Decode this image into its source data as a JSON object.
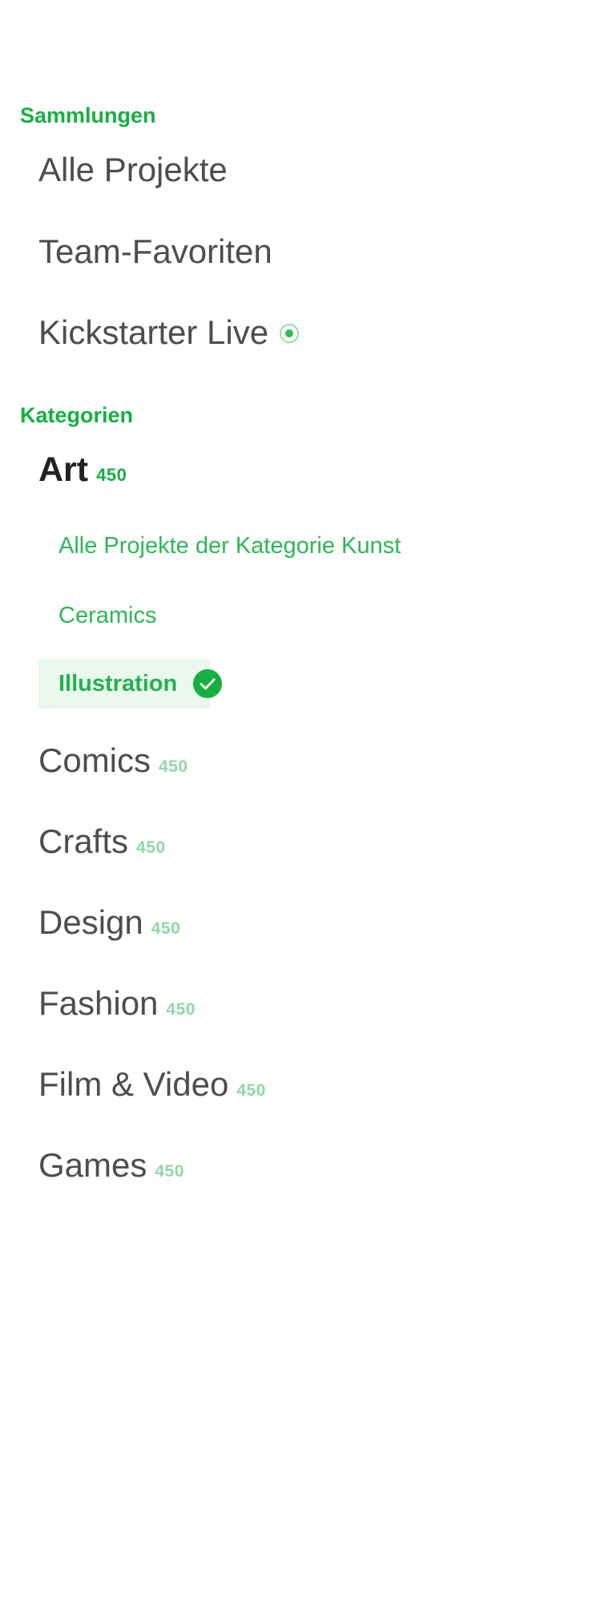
{
  "collections": {
    "header": "Sammlungen",
    "items": [
      {
        "label": "Alle Projekte"
      },
      {
        "label": "Team-Favoriten"
      },
      {
        "label": "Kickstarter Live",
        "indicator": "live-dot-icon"
      }
    ]
  },
  "categories": {
    "header": "Kategorien",
    "active": {
      "label": "Art",
      "count": "450",
      "subitems": [
        {
          "label": "Alle Projekte der Kategorie Kunst",
          "selected": false
        },
        {
          "label": "Ceramics",
          "selected": false
        },
        {
          "label": "Illustration",
          "selected": true,
          "icon": "check-circle-icon"
        }
      ]
    },
    "items": [
      {
        "label": "Comics",
        "count": "450"
      },
      {
        "label": "Crafts",
        "count": "450"
      },
      {
        "label": "Design",
        "count": "450"
      },
      {
        "label": "Fashion",
        "count": "450"
      },
      {
        "label": "Film & Video",
        "count": "450"
      },
      {
        "label": "Games",
        "count": "450"
      }
    ]
  },
  "colors": {
    "accent": "#15b040",
    "accent_light": "#8fd9a6",
    "selected_bg": "#eaf8ee",
    "text": "#4d4d4d",
    "text_active": "#222222"
  }
}
